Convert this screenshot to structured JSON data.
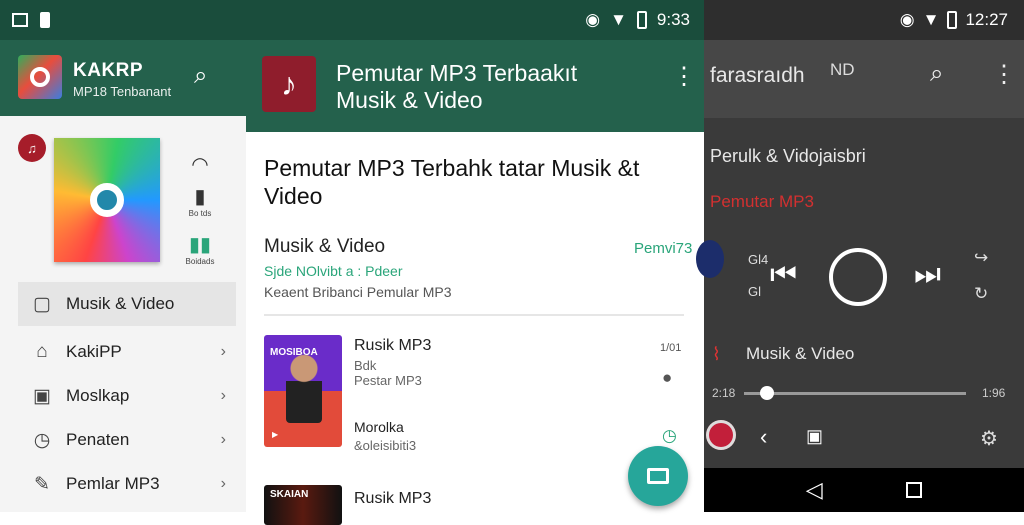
{
  "left_status": {
    "icons": [
      "image-icon",
      "sim-icon"
    ]
  },
  "mid_status": {
    "time": "9:33",
    "icons": [
      "hotspot-icon",
      "wifi-icon",
      "battery-icon"
    ]
  },
  "left_app": {
    "title": "KAKRP",
    "subtitle": "MP18 Tenbanant"
  },
  "left_side_icons": {
    "a": "Bo tds",
    "b": "Boidads"
  },
  "drawer": {
    "items": [
      {
        "label": "Musik & Video",
        "icon": "folder-icon"
      },
      {
        "label": "KakiPP",
        "icon": "folder-icon"
      },
      {
        "label": "Moslkap",
        "icon": "square-icon"
      },
      {
        "label": "Penaten",
        "icon": "clock-icon"
      },
      {
        "label": "Pemlar MP3",
        "icon": "pencil-icon"
      }
    ]
  },
  "mid_app": {
    "title": "Pemutar MP3 Terbaakıt Musik & Video"
  },
  "mid_content": {
    "heading": "Pemutar MP3 Terbahk tatar Musik  &t Video",
    "section_title": "Musik & Video",
    "section_right": "Pemvi73",
    "green_sub": "Sjde NOlvibt a : Pdeer",
    "grey_sub": "Keaent Bribanci Pemular MP3",
    "tracks": [
      {
        "title": "Rusik MP3",
        "meta1": "Bdk",
        "meta2": "Pestar MP3",
        "time": "1/01",
        "thumb_label": "MOSIBOA"
      },
      {
        "title": "Morolka",
        "meta1": "&oleisibiti3",
        "meta2": "",
        "time": "",
        "thumb_label": ""
      },
      {
        "title": "Rusik MP3",
        "meta1": "",
        "meta2": "",
        "time": "",
        "thumb_label": "SKAIAN"
      }
    ]
  },
  "right_status": {
    "time": "12:27"
  },
  "right_app": {
    "title": "farasraıdh",
    "nd": "ND"
  },
  "player": {
    "track_title": "Perulk & Vidojaisbri",
    "artist": "Pemutar MP3",
    "left_ic_top": "Gl4",
    "left_ic_bottom": "Gl",
    "genre": "Musik & Video",
    "time_left": "2:18",
    "time_right": "1:96"
  },
  "colors": {
    "appbar": "#24614c",
    "status": "#1a4d3c",
    "fab": "#26a69a",
    "accent_red": "#d33030",
    "accent_green": "#2aa57a"
  }
}
